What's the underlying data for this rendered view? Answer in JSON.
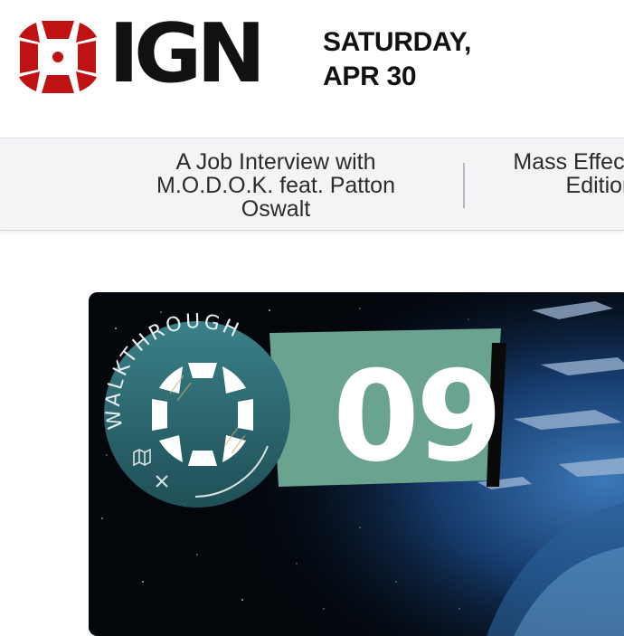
{
  "header": {
    "logo_text": "IGN",
    "date_line1": "SATURDAY,",
    "date_line2": "APR 30"
  },
  "ticker": {
    "items": [
      {
        "title": "A Job Interview with M.O.D.O.K. feat. Patton Oswalt"
      },
      {
        "title": "Mass Effect Legendary Edition - X S"
      }
    ]
  },
  "hero": {
    "badge_label": "WALKTHROUGH",
    "episode_number": "09"
  },
  "colors": {
    "brand_red": "#bf1313",
    "text_dark": "#111111",
    "ticker_bg": "#f4f4f6",
    "badge_teal": "#2f6d72",
    "banner_green": "#6ba391"
  },
  "icons": [
    "ign-logo-icon",
    "map-icon",
    "close-icon"
  ]
}
